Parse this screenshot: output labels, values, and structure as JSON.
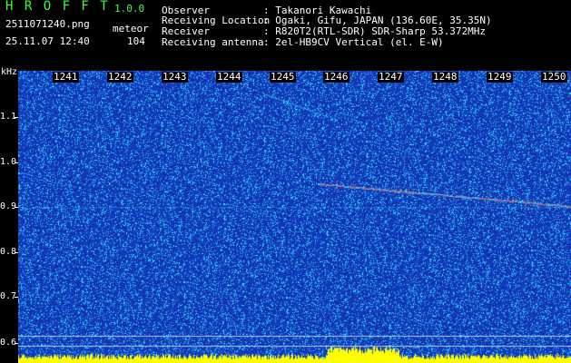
{
  "app": {
    "name": "H R O F F T",
    "version": "1.0.0"
  },
  "file": {
    "name": "2511071240.png",
    "datetime": "25.11.07 12:40",
    "category": "meteor",
    "count": "104"
  },
  "info": {
    "observer_label": "Observer",
    "observer_value": ": Takanori Kawachi",
    "location_label": "Receiving Location",
    "location_value": ": Ogaki, Gifu, JAPAN (136.60E, 35.35N)",
    "receiver_label": "Receiver",
    "receiver_value": ": R820T2(RTL-SDR) SDR-Sharp 53.372MHz",
    "antenna_label": "Receiving antenna",
    "antenna_value": ": 2el-HB9CV Vertical (el. E-W)"
  },
  "axis": {
    "y_unit": "kHz",
    "y_ticks": [
      "1.1",
      "1.0",
      "0.9",
      "0.8",
      "0.7",
      "0.6"
    ],
    "x_ticks": [
      "1241",
      "1242",
      "1243",
      "1244",
      "1245",
      "1246",
      "1247",
      "1248",
      "1249",
      "1250"
    ]
  },
  "colors": {
    "background": "#000000",
    "spectrogram_base": "#1a2fb0",
    "signal_cyan": "#36e0ff",
    "signal_red": "#ff5050",
    "noise_floor": "#ffff00",
    "app_title": "#3cff3c"
  }
}
